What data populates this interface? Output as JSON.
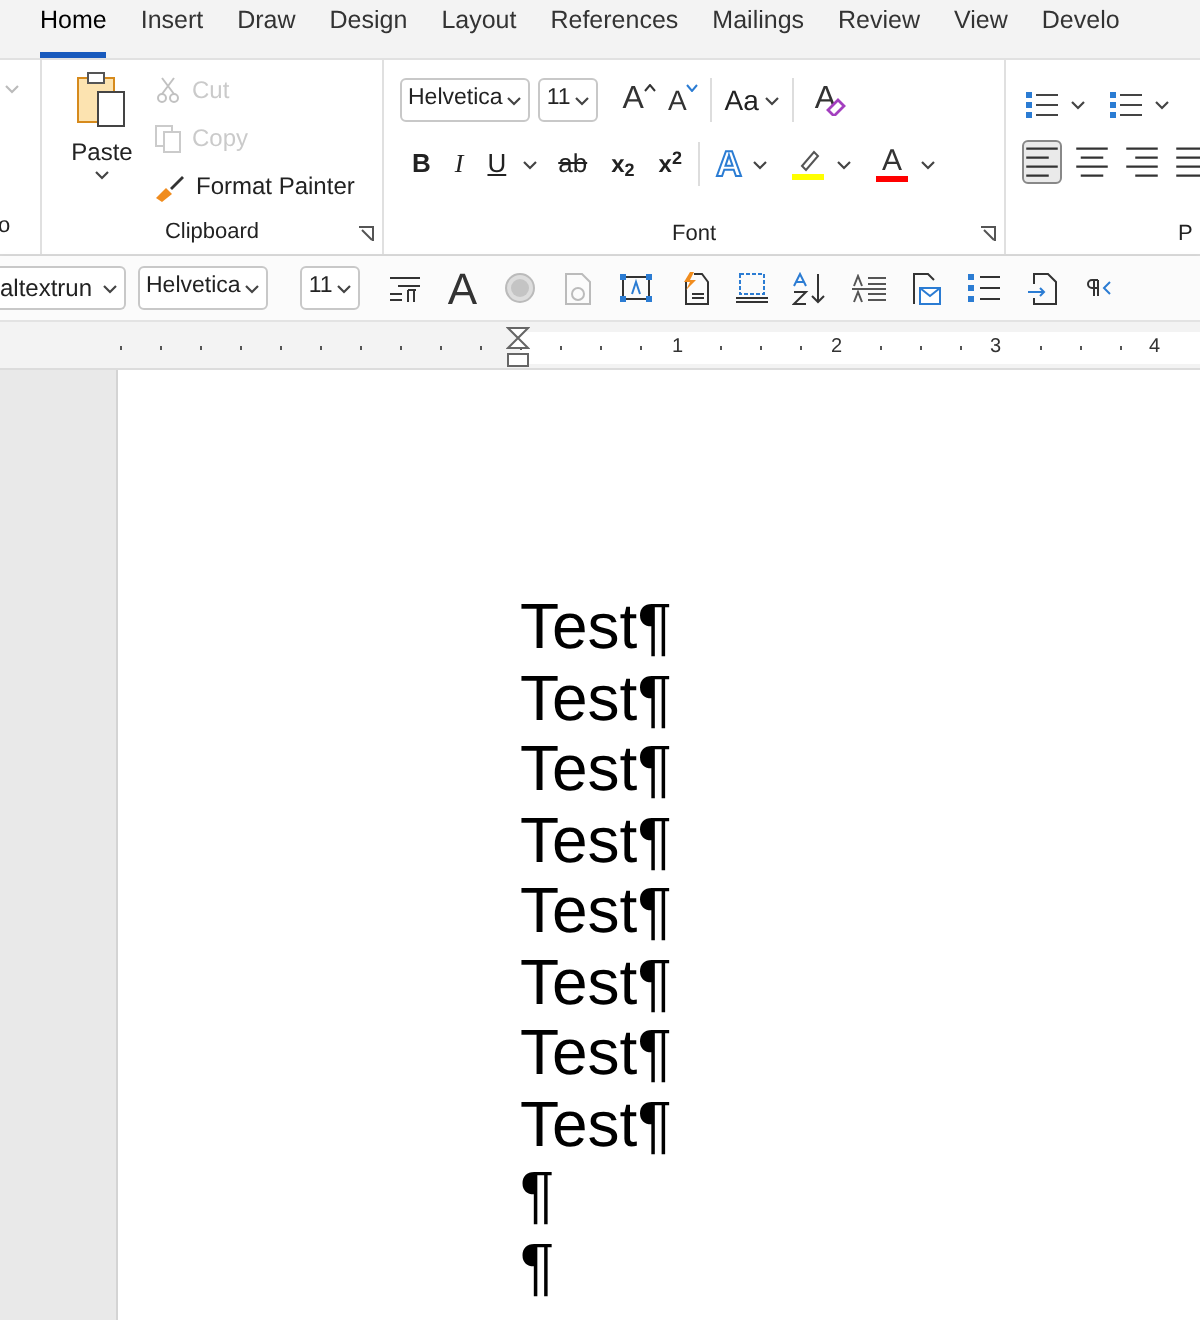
{
  "tabs": [
    {
      "label": "Home",
      "selected": true
    },
    {
      "label": "Insert",
      "selected": false
    },
    {
      "label": "Draw",
      "selected": false
    },
    {
      "label": "Design",
      "selected": false
    },
    {
      "label": "Layout",
      "selected": false
    },
    {
      "label": "References",
      "selected": false
    },
    {
      "label": "Mailings",
      "selected": false
    },
    {
      "label": "Review",
      "selected": false
    },
    {
      "label": "View",
      "selected": false
    },
    {
      "label": "Develo",
      "selected": false
    }
  ],
  "ribbon": {
    "clipped_group": {
      "label": "o"
    },
    "clipboard": {
      "label": "Clipboard",
      "paste": "Paste",
      "cut": {
        "label": "Cut",
        "disabled": true
      },
      "copy": {
        "label": "Copy",
        "disabled": true
      },
      "format_painter": {
        "label": "Format Painter",
        "disabled": false
      }
    },
    "font": {
      "label": "Font",
      "font_name": "Helvetica",
      "font_size": "11",
      "grow": "A",
      "shrink": "A",
      "change_case": "Aa",
      "clear": "A",
      "bold": "B",
      "italic": "I",
      "underline": "U",
      "strikethrough": "ab",
      "subscript": "x$_{2}$",
      "superscript": "x$^{2}$",
      "effects": "A",
      "font_color": "A"
    },
    "paragraph": {
      "label": "P",
      "alignments": [
        {
          "selected": true
        },
        {
          "selected": false
        },
        {
          "selected": false
        },
        {
          "selected": false
        }
      ]
    }
  },
  "quick_toolbar": {
    "style": "altextrun",
    "font_name": "Helvetica",
    "font_size": "11",
    "font_button": "A"
  },
  "ruler": {
    "numbers": [
      "1",
      "2",
      "3",
      "4"
    ]
  },
  "document": {
    "paragraphs": [
      "Test¶",
      "Test¶",
      "Test¶",
      "Test¶",
      "Test¶",
      "Test¶",
      "Test¶",
      "Test¶",
      "¶",
      "¶"
    ]
  }
}
